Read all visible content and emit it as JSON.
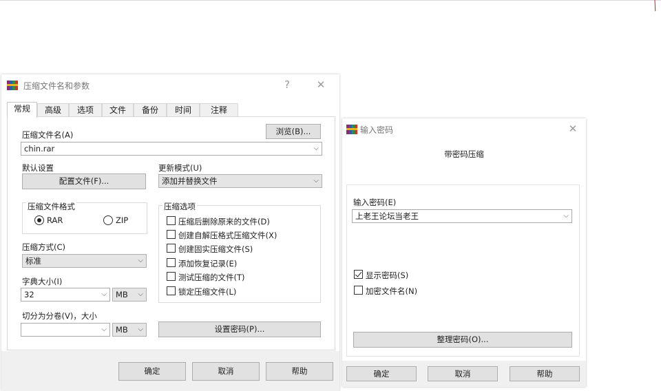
{
  "archive_dialog": {
    "title": "压缩文件名和参数",
    "help_glyph": "?",
    "close_glyph": "✕",
    "tabs": [
      "常规",
      "高级",
      "选项",
      "文件",
      "备份",
      "时间",
      "注释"
    ],
    "archive_name_label": "压缩文件名(A)",
    "browse_button": "浏览(B)...",
    "archive_name_value": "chin.rar",
    "default_settings_label": "默认设置",
    "profiles_button": "配置文件(F)...",
    "update_mode_label": "更新模式(U)",
    "update_mode_value": "添加并替换文件",
    "format_group_label": "压缩文件格式",
    "format_options": [
      "RAR",
      "ZIP"
    ],
    "format_selected": "RAR",
    "method_label": "压缩方式(C)",
    "method_value": "标准",
    "dict_label": "字典大小(I)",
    "dict_value": "32",
    "dict_unit": "MB",
    "split_label": "切分为分卷(V)，大小",
    "split_value": "",
    "split_unit": "MB",
    "options_group_label": "压缩选项",
    "options": [
      {
        "label": "压缩后删除原来的文件(D)",
        "checked": false
      },
      {
        "label": "创建自解压格式压缩文件(X)",
        "checked": false
      },
      {
        "label": "创建固实压缩文件(S)",
        "checked": false
      },
      {
        "label": "添加恢复记录(E)",
        "checked": false
      },
      {
        "label": "测试压缩的文件(T)",
        "checked": false
      },
      {
        "label": "锁定压缩文件(L)",
        "checked": false
      }
    ],
    "set_password_button": "设置密码(P)...",
    "ok_button": "确定",
    "cancel_button": "取消",
    "help_button": "帮助"
  },
  "password_dialog": {
    "title": "输入密码",
    "close_glyph": "✕",
    "heading": "带密码压缩",
    "password_label": "输入密码(E)",
    "password_value": "上老王论坛当老王",
    "show_password": {
      "label": "显示密码(S)",
      "checked": true
    },
    "encrypt_names": {
      "label": "加密文件名(N)",
      "checked": false
    },
    "organize_button": "整理密码(O)...",
    "ok_button": "确定",
    "cancel_button": "取消",
    "help_button": "帮助"
  },
  "dropdown_glyph": "⌵",
  "corner_glyph": "╱",
  "colors": {
    "window_bg": "#f0f0f0",
    "button_bg": "#e1e1e1",
    "accent_mark": "#d21a1a"
  }
}
